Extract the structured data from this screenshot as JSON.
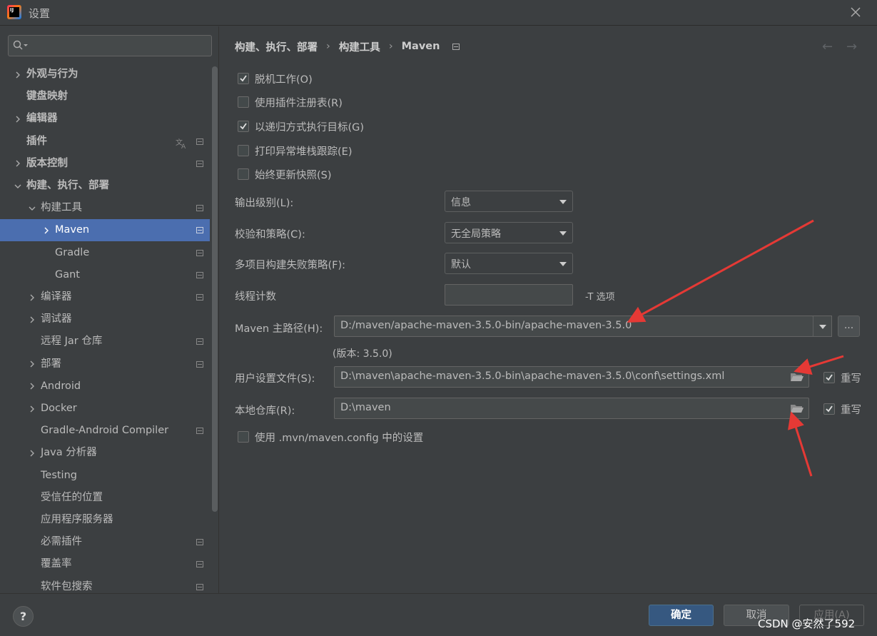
{
  "window": {
    "title": "设置"
  },
  "search": {
    "placeholder": ""
  },
  "sidebar": {
    "items": [
      {
        "label": "外观与行为",
        "bold": true,
        "expandable": true,
        "expanded": false
      },
      {
        "label": "键盘映射",
        "bold": true
      },
      {
        "label": "编辑器",
        "bold": true,
        "expandable": true,
        "expanded": false
      },
      {
        "label": "插件",
        "bold": true,
        "translate_icon": true,
        "project_icon": true
      },
      {
        "label": "版本控制",
        "bold": true,
        "expandable": true,
        "expanded": false,
        "project_icon": true
      },
      {
        "label": "构建、执行、部署",
        "bold": true,
        "expandable": true,
        "expanded": true
      },
      {
        "label": "构建工具",
        "expandable": true,
        "expanded": true,
        "project_icon": true
      },
      {
        "label": "Maven",
        "expandable": true,
        "expanded": false,
        "selected": true,
        "project_icon": true
      },
      {
        "label": "Gradle",
        "project_icon": true
      },
      {
        "label": "Gant",
        "project_icon": true
      },
      {
        "label": "编译器",
        "expandable": true,
        "expanded": false,
        "project_icon": true
      },
      {
        "label": "调试器",
        "expandable": true,
        "expanded": false
      },
      {
        "label": "远程 Jar 仓库",
        "project_icon": true
      },
      {
        "label": "部署",
        "expandable": true,
        "expanded": false,
        "project_icon": true
      },
      {
        "label": "Android",
        "expandable": true,
        "expanded": false
      },
      {
        "label": "Docker",
        "expandable": true,
        "expanded": false
      },
      {
        "label": "Gradle-Android Compiler",
        "project_icon": true
      },
      {
        "label": "Java 分析器",
        "expandable": true,
        "expanded": false
      },
      {
        "label": "Testing"
      },
      {
        "label": "受信任的位置"
      },
      {
        "label": "应用程序服务器"
      },
      {
        "label": "必需插件",
        "project_icon": true
      },
      {
        "label": "覆盖率",
        "project_icon": true
      },
      {
        "label": "软件包搜索",
        "project_icon": true
      }
    ]
  },
  "breadcrumb": {
    "part1": "构建、执行、部署",
    "part2": "构建工具",
    "part3": "Maven",
    "sep": "›"
  },
  "nav": {
    "back": "←",
    "forward": "→"
  },
  "checkboxes": [
    {
      "label": "脱机工作(O)",
      "checked": true
    },
    {
      "label": "使用插件注册表(R)",
      "checked": false
    },
    {
      "label": "以递归方式执行目标(G)",
      "checked": true
    },
    {
      "label": "打印异常堆栈跟踪(E)",
      "checked": false
    },
    {
      "label": "始终更新快照(S)",
      "checked": false
    }
  ],
  "form": {
    "output_level_label": "输出级别(L):",
    "output_level_value": "信息",
    "checksum_label": "校验和策略(C):",
    "checksum_value": "无全局策略",
    "multiproject_label": "多项目构建失败策略(F):",
    "multiproject_value": "默认",
    "threads_label": "线程计数",
    "threads_value": "",
    "threads_hint": "-T 选项",
    "maven_home_label": "Maven 主路径(H):",
    "maven_home_value": "D:/maven/apache-maven-3.5.0-bin/apache-maven-3.5.0",
    "ellipsis": "...",
    "version_text": "(版本: 3.5.0)",
    "user_settings_label": "用户设置文件(S):",
    "user_settings_value": "D:\\maven\\apache-maven-3.5.0-bin\\apache-maven-3.5.0\\conf\\settings.xml",
    "override_label": "重写",
    "local_repo_label": "本地仓库(R):",
    "local_repo_value": "D:\\maven",
    "override_label2": "重写",
    "mvn_config_label": "使用 .mvn/maven.config 中的设置"
  },
  "footer": {
    "help": "?",
    "ok": "确定",
    "cancel": "取消",
    "apply": "应用(A)"
  },
  "watermark": "CSDN @安然了592",
  "colors": {
    "background": "#3c3f41",
    "selection": "#4b6eaf",
    "primary_button": "#365880",
    "annotation_arrow": "#e53935"
  }
}
